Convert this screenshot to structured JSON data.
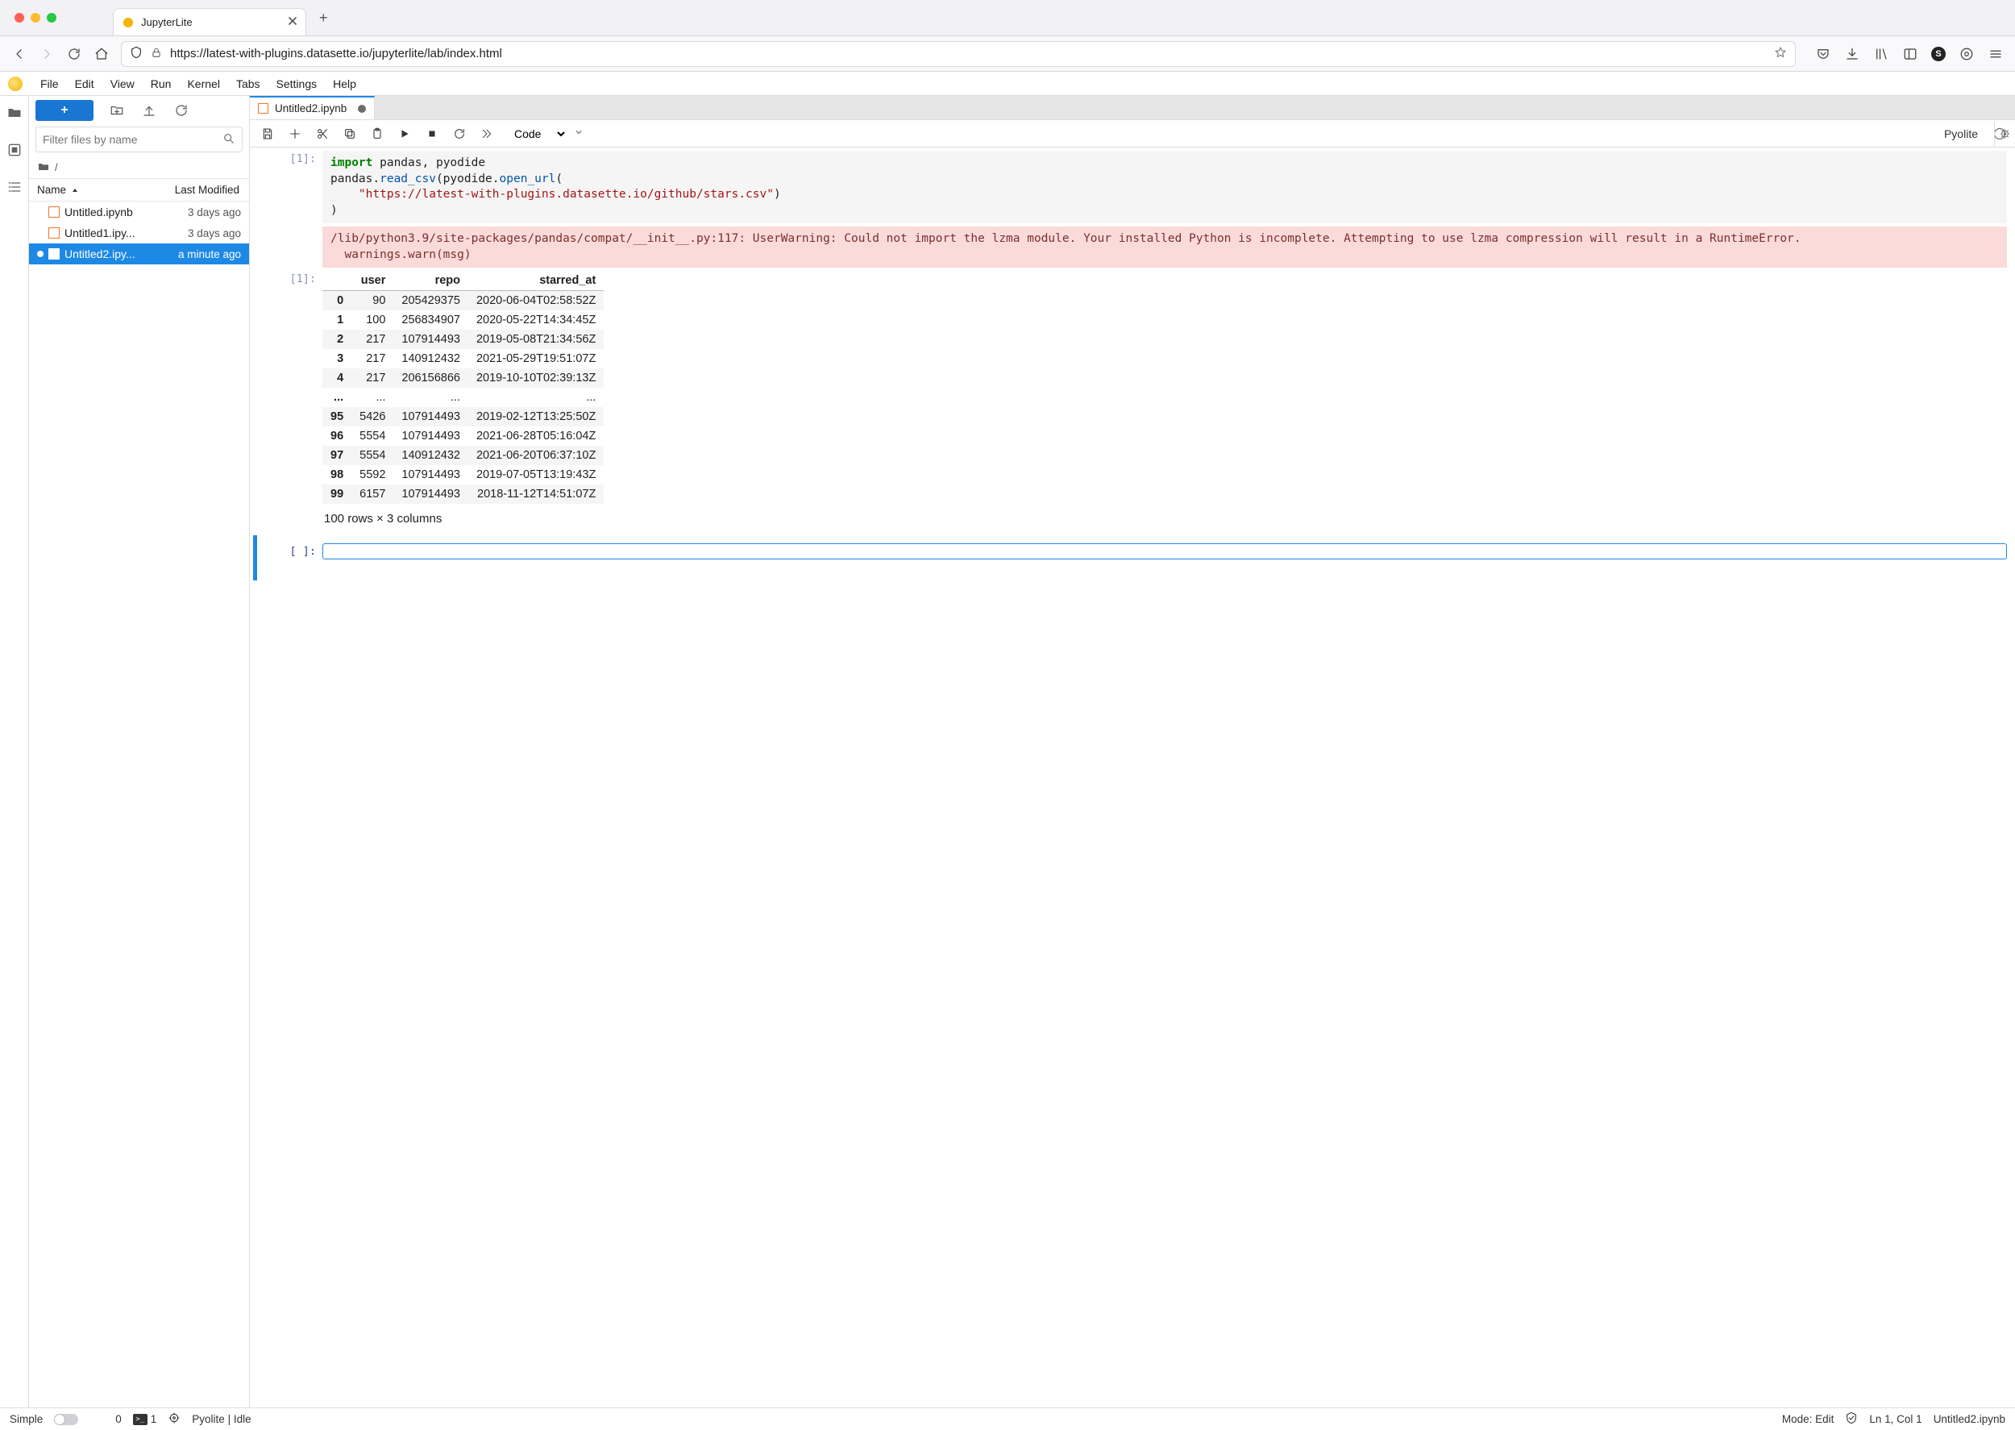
{
  "browser": {
    "tab_title": "JupyterLite",
    "url": "https://latest-with-plugins.datasette.io/jupyterlite/lab/index.html",
    "avatar_initial": "S"
  },
  "menus": [
    "File",
    "Edit",
    "View",
    "Run",
    "Kernel",
    "Tabs",
    "Settings",
    "Help"
  ],
  "filebrowser": {
    "filter_placeholder": "Filter files by name",
    "breadcrumb_sep": "/",
    "col_name": "Name",
    "col_modified": "Last Modified",
    "files": [
      {
        "name": "Untitled.ipynb",
        "modified": "3 days ago",
        "selected": false,
        "dirty": false
      },
      {
        "name": "Untitled1.ipy...",
        "modified": "3 days ago",
        "selected": false,
        "dirty": false
      },
      {
        "name": "Untitled2.ipy...",
        "modified": "a minute ago",
        "selected": true,
        "dirty": true
      }
    ]
  },
  "main": {
    "tab_label": "Untitled2.ipynb",
    "cell_type": "Code",
    "kernel_name": "Pyolite"
  },
  "cells": {
    "in_prompt": "[1]:",
    "out_prompt": "[1]:",
    "empty_prompt": "[ ]:",
    "code_tokens": {
      "kw_import": "import",
      "rest1": " pandas, pyodide",
      "line2a": "pandas.",
      "fn_read": "read_csv",
      "line2b": "(pyodide.",
      "fn_open": "open_url",
      "line2c": "(",
      "str_url": "\"https://latest-with-plugins.datasette.io/github/stars.csv\"",
      "line2d": ")",
      "line3": ")"
    },
    "warn_text": "/lib/python3.9/site-packages/pandas/compat/__init__.py:117: UserWarning: Could not import the lzma module. Your installed Python is incomplete. Attempting to use lzma compression will result in a RuntimeError.\n  warnings.warn(msg)",
    "df": {
      "columns": [
        "user",
        "repo",
        "starred_at"
      ],
      "rows": [
        {
          "idx": "0",
          "user": "90",
          "repo": "205429375",
          "starred_at": "2020-06-04T02:58:52Z"
        },
        {
          "idx": "1",
          "user": "100",
          "repo": "256834907",
          "starred_at": "2020-05-22T14:34:45Z"
        },
        {
          "idx": "2",
          "user": "217",
          "repo": "107914493",
          "starred_at": "2019-05-08T21:34:56Z"
        },
        {
          "idx": "3",
          "user": "217",
          "repo": "140912432",
          "starred_at": "2021-05-29T19:51:07Z"
        },
        {
          "idx": "4",
          "user": "217",
          "repo": "206156866",
          "starred_at": "2019-10-10T02:39:13Z"
        },
        {
          "idx": "...",
          "user": "...",
          "repo": "...",
          "starred_at": "..."
        },
        {
          "idx": "95",
          "user": "5426",
          "repo": "107914493",
          "starred_at": "2019-02-12T13:25:50Z"
        },
        {
          "idx": "96",
          "user": "5554",
          "repo": "107914493",
          "starred_at": "2021-06-28T05:16:04Z"
        },
        {
          "idx": "97",
          "user": "5554",
          "repo": "140912432",
          "starred_at": "2021-06-20T06:37:10Z"
        },
        {
          "idx": "98",
          "user": "5592",
          "repo": "107914493",
          "starred_at": "2019-07-05T13:19:43Z"
        },
        {
          "idx": "99",
          "user": "6157",
          "repo": "107914493",
          "starred_at": "2018-11-12T14:51:07Z"
        }
      ],
      "summary": "100 rows × 3 columns"
    }
  },
  "status": {
    "simple": "Simple",
    "consoles_n": "0",
    "terminals_n": "1",
    "kernel_status": "Pyolite | Idle",
    "mode": "Mode: Edit",
    "cursor": "Ln 1, Col 1",
    "file": "Untitled2.ipynb"
  }
}
